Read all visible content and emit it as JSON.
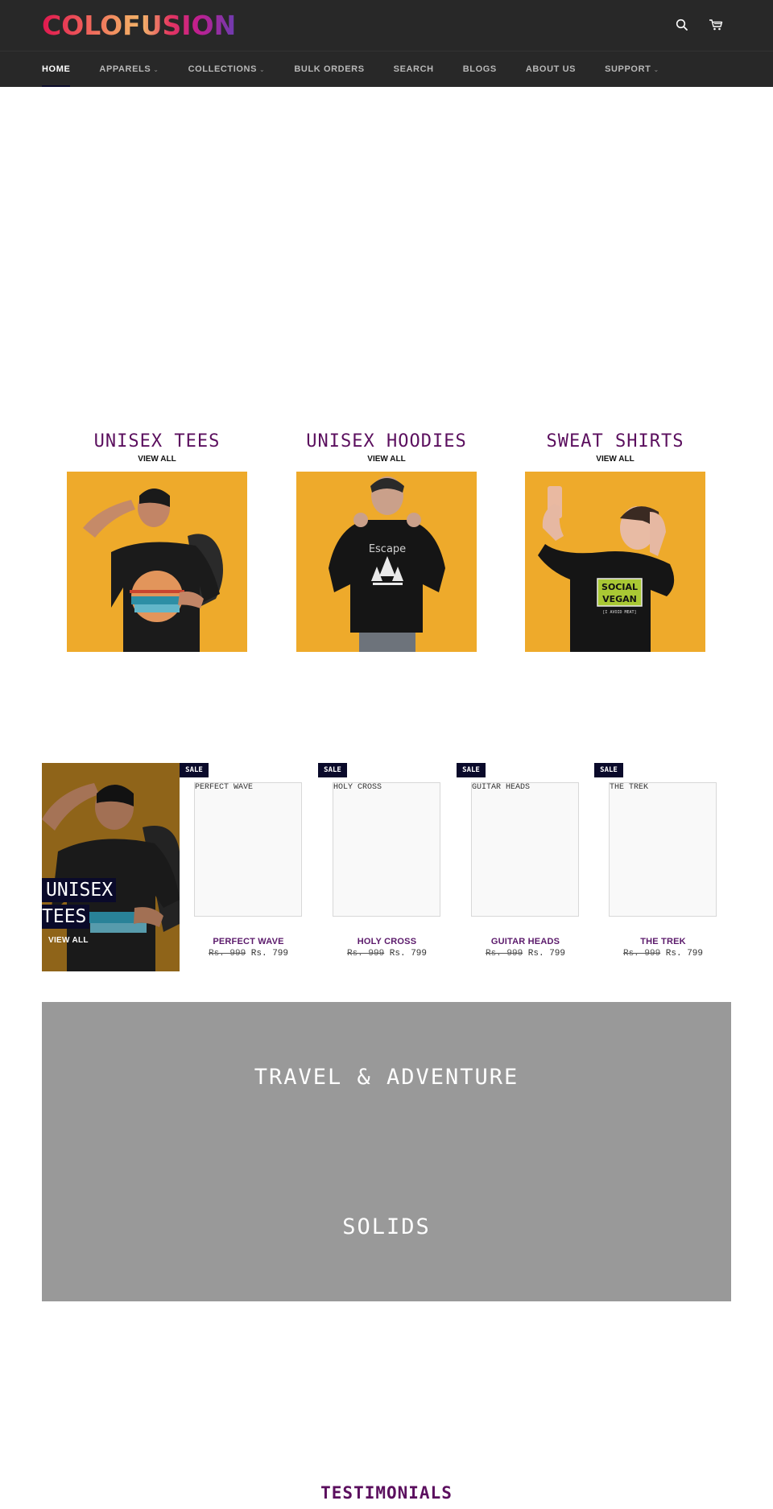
{
  "header": {
    "logo_text": "COLOFUSION",
    "icons": {
      "search": "search-icon",
      "cart": "cart-icon"
    }
  },
  "nav": {
    "items": [
      {
        "label": "HOME",
        "active": true,
        "has_dropdown": false
      },
      {
        "label": "APPARELS",
        "active": false,
        "has_dropdown": true
      },
      {
        "label": "COLLECTIONS",
        "active": false,
        "has_dropdown": true
      },
      {
        "label": "BULK ORDERS",
        "active": false,
        "has_dropdown": false
      },
      {
        "label": "SEARCH",
        "active": false,
        "has_dropdown": false
      },
      {
        "label": "BLOGS",
        "active": false,
        "has_dropdown": false
      },
      {
        "label": "ABOUT US",
        "active": false,
        "has_dropdown": false
      },
      {
        "label": "SUPPORT",
        "active": false,
        "has_dropdown": true
      }
    ],
    "dropdown_glyph": "⌄"
  },
  "collections": [
    {
      "title": "UNISEX TEES",
      "link": "VIEW ALL",
      "image": "man-backpack-tee",
      "print_text": ""
    },
    {
      "title": "UNISEX HOODIES",
      "link": "VIEW ALL",
      "image": "man-black-hoodie",
      "print_text": "Escape"
    },
    {
      "title": "SWEAT SHIRTS",
      "link": "VIEW ALL",
      "image": "woman-selfie-sweatshirt",
      "print_text": "SOCIAL VEGAN",
      "print_sub": "[I AVOID MEAT]"
    }
  ],
  "featured": {
    "title_line1": "UNISEX",
    "title_line2": "TEES",
    "link": "VIEW ALL"
  },
  "products": [
    {
      "badge": "SALE",
      "image_alt": "PERFECT WAVE",
      "name": "PERFECT WAVE",
      "old_price": "Rs. 999",
      "price": "Rs. 799"
    },
    {
      "badge": "SALE",
      "image_alt": "HOLY CROSS",
      "name": "HOLY CROSS",
      "old_price": "Rs. 999",
      "price": "Rs. 799"
    },
    {
      "badge": "SALE",
      "image_alt": "GUITAR HEADS",
      "name": "GUITAR HEADS",
      "old_price": "Rs. 999",
      "price": "Rs. 799"
    },
    {
      "badge": "SALE",
      "image_alt": "THE TREK",
      "name": "THE TREK",
      "old_price": "Rs. 999",
      "price": "Rs. 799"
    }
  ],
  "banner": {
    "items": [
      "TRAVEL & ADVENTURE",
      "SOLIDS"
    ]
  },
  "testimonials": {
    "title": "TESTIMONIALS"
  },
  "colors": {
    "header_bg": "#282828",
    "accent_purple": "#5b0f5e",
    "badge_navy": "#0a0a2a",
    "tile_mustard": "#eeaa2b",
    "banner_gray": "#999999"
  }
}
